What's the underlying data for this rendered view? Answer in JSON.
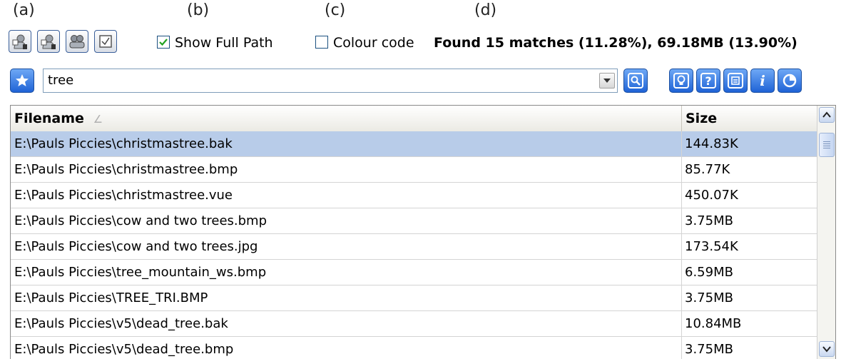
{
  "captions": [
    "(a)",
    "(b)",
    "(c)",
    "(d)"
  ],
  "toolbar": {
    "buttons": [
      {
        "name": "search-archive-button",
        "icon": "search-user-a-icon"
      },
      {
        "name": "search-history-button",
        "icon": "search-user-h-icon"
      },
      {
        "name": "users-button",
        "icon": "users-icon"
      },
      {
        "name": "select-all-button",
        "icon": "checkbox-icon"
      }
    ],
    "show_full_path": {
      "label": "Show Full Path",
      "checked": true
    },
    "colour_code": {
      "label": "Colour code",
      "checked": false
    },
    "found_text": "Found 15 matches (11.28%), 69.18MB (13.90%)"
  },
  "search": {
    "value": "tree",
    "icons": [
      "star-icon",
      "search-icon",
      "bulb-icon",
      "help-icon",
      "save-icon",
      "info-icon",
      "pie-chart-icon"
    ]
  },
  "table": {
    "columns": {
      "filename": "Filename",
      "size": "Size"
    },
    "sort_indicator": "∠",
    "rows": [
      {
        "filename": "E:\\Pauls Piccies\\christmastree.bak",
        "size": "144.83K",
        "selected": true
      },
      {
        "filename": "E:\\Pauls Piccies\\christmastree.bmp",
        "size": "85.77K"
      },
      {
        "filename": "E:\\Pauls Piccies\\christmastree.vue",
        "size": "450.07K"
      },
      {
        "filename": "E:\\Pauls Piccies\\cow and two trees.bmp",
        "size": "3.75MB"
      },
      {
        "filename": "E:\\Pauls Piccies\\cow and two trees.jpg",
        "size": "173.54K"
      },
      {
        "filename": "E:\\Pauls Piccies\\tree_mountain_ws.bmp",
        "size": "6.59MB"
      },
      {
        "filename": "E:\\Pauls Piccies\\TREE_TRI.BMP",
        "size": "3.75MB"
      },
      {
        "filename": "E:\\Pauls Piccies\\v5\\dead_tree.bak",
        "size": "10.84MB"
      },
      {
        "filename": "E:\\Pauls Piccies\\v5\\dead_tree.bmp",
        "size": "3.75MB"
      }
    ]
  },
  "colors": {
    "selection": "#b8cce9",
    "accent_blue": "#1f63d6"
  }
}
